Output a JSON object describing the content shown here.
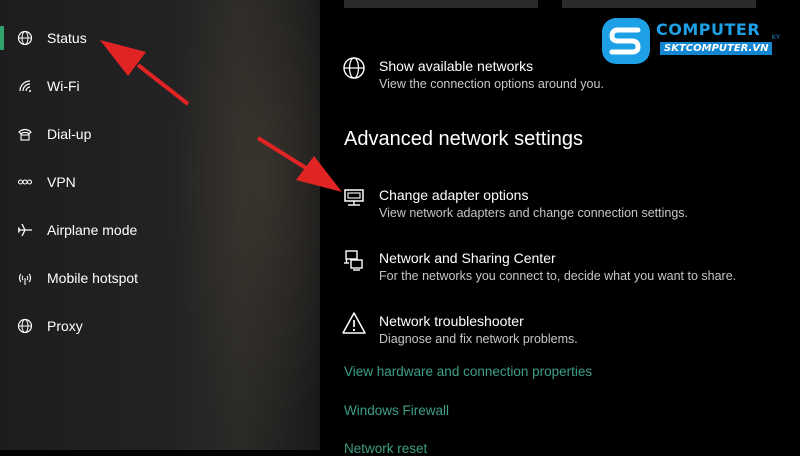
{
  "sidebar": {
    "items": [
      {
        "label": "Status",
        "icon": "globe-icon",
        "active": true
      },
      {
        "label": "Wi-Fi",
        "icon": "wifi-icon"
      },
      {
        "label": "Dial-up",
        "icon": "dialup-icon"
      },
      {
        "label": "VPN",
        "icon": "vpn-icon"
      },
      {
        "label": "Airplane mode",
        "icon": "airplane-icon"
      },
      {
        "label": "Mobile hotspot",
        "icon": "hotspot-icon"
      },
      {
        "label": "Proxy",
        "icon": "globe-icon"
      }
    ],
    "accent": "#2fa36b"
  },
  "main": {
    "show_networks": {
      "title": "Show available networks",
      "desc": "View the connection options around you."
    },
    "section_heading": "Advanced network settings",
    "items": [
      {
        "title": "Change adapter options",
        "desc": "View network adapters and change connection settings.",
        "icon": "adapter-icon"
      },
      {
        "title": "Network and Sharing Center",
        "desc": "For the networks you connect to, decide what you want to share.",
        "icon": "sharing-center-icon"
      },
      {
        "title": "Network troubleshooter",
        "desc": "Diagnose and fix network problems.",
        "icon": "warning-icon"
      }
    ],
    "links": [
      "View hardware and connection properties",
      "Windows Firewall",
      "Network reset"
    ],
    "link_color": "#3c9f86"
  },
  "watermark": {
    "brand": "COMPUTER",
    "sub": "SKTCOMPUTER.VN",
    "tiny": "KY"
  },
  "annotations": {
    "arrow_color": "#e02424"
  }
}
